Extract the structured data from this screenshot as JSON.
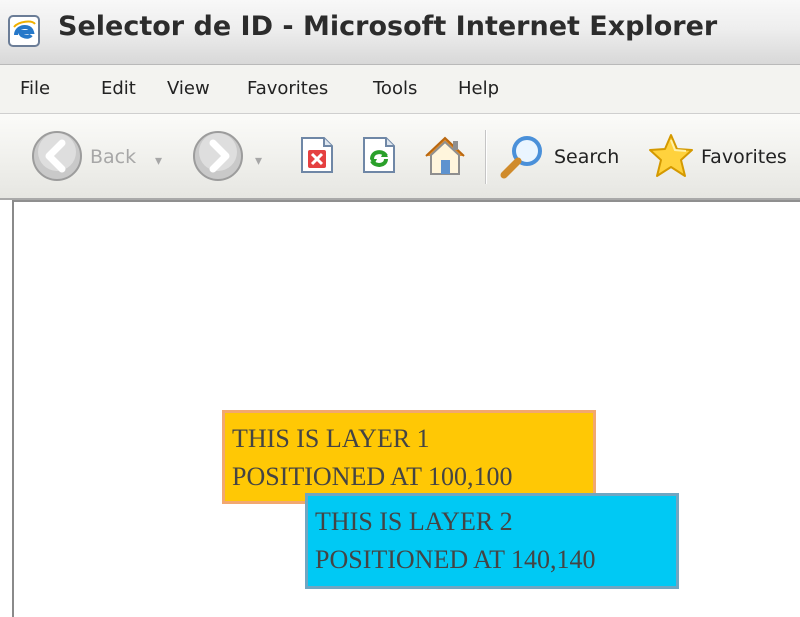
{
  "window": {
    "title": "Selector de ID - Microsoft Internet Explorer",
    "icon": "ie-page-icon"
  },
  "menubar": {
    "items": [
      {
        "label": "File"
      },
      {
        "label": "Edit"
      },
      {
        "label": "View"
      },
      {
        "label": "Favorites"
      },
      {
        "label": "Tools"
      },
      {
        "label": "Help"
      }
    ]
  },
  "toolbar": {
    "back_label": "Back",
    "search_label": "Search",
    "favorites_label": "Favorites",
    "icons": {
      "back": "back-arrow-icon",
      "forward": "forward-arrow-icon",
      "stop": "stop-icon",
      "refresh": "refresh-icon",
      "home": "home-icon",
      "search": "search-icon",
      "favorites": "star-icon"
    }
  },
  "page": {
    "layer1": {
      "line1": "THIS IS LAYER 1",
      "line2": "POSITIONED AT 100,100",
      "color": "#ffc805"
    },
    "layer2": {
      "line1": "THIS IS LAYER 2",
      "line2": "POSITIONED AT 140,140",
      "color": "#00c9f4"
    }
  }
}
